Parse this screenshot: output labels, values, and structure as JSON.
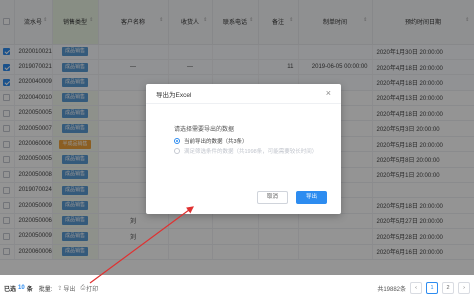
{
  "table": {
    "columns": [
      "流水号",
      "销售类型",
      "客户名称",
      "收货人",
      "联系电话",
      "备注",
      "制单时间",
      "预约时间日期"
    ],
    "rows": [
      {
        "checked": true,
        "id": "2020010021",
        "type": "成品销售",
        "type_color": "blue",
        "customer": "",
        "receiver": "",
        "phone": "",
        "note": "",
        "created": "",
        "appt": "2020年1月30日 20:00:00"
      },
      {
        "checked": true,
        "id": "2019070021",
        "type": "成品销售",
        "type_color": "blue",
        "customer": "—",
        "receiver": "—",
        "phone": "",
        "note": "11",
        "created": "2019-06-05 00:00:00",
        "appt": "2020年4月18日 20:00:00"
      },
      {
        "checked": true,
        "id": "2020040009",
        "type": "成品销售",
        "type_color": "blue",
        "customer": "",
        "receiver": "",
        "phone": "",
        "note": "",
        "created": "",
        "appt": "2020年4月18日 20:00:00"
      },
      {
        "checked": false,
        "id": "2020040010",
        "type": "成品销售",
        "type_color": "blue",
        "customer": "",
        "receiver": "",
        "phone": "",
        "note": "",
        "created": "",
        "appt": "2020年4月13日 20:00:00"
      },
      {
        "checked": false,
        "id": "2020050005",
        "type": "成品销售",
        "type_color": "blue",
        "customer": "",
        "receiver": "",
        "phone": "",
        "note": "",
        "created": "",
        "appt": "2020年4月18日 20:00:00"
      },
      {
        "checked": false,
        "id": "2020050007",
        "type": "成品销售",
        "type_color": "blue",
        "customer": "",
        "receiver": "",
        "phone": "",
        "note": "",
        "created": "",
        "appt": "2020年5月3日 20:00:00"
      },
      {
        "checked": false,
        "id": "2020060006",
        "type": "半成品销售",
        "type_color": "orange",
        "customer": "",
        "receiver": "",
        "phone": "",
        "note": "",
        "created": "",
        "appt": "2020年5月18日 20:00:00"
      },
      {
        "checked": false,
        "id": "2020050005",
        "type": "成品销售",
        "type_color": "blue",
        "customer": "",
        "receiver": "",
        "phone": "",
        "note": "",
        "created": "",
        "appt": "2020年5月8日 20:00:00"
      },
      {
        "checked": false,
        "id": "2020050008",
        "type": "成品销售",
        "type_color": "blue",
        "customer": "",
        "receiver": "",
        "phone": "",
        "note": "",
        "created": "",
        "appt": "2020年5月1日 20:00:00"
      },
      {
        "checked": false,
        "id": "2019070024",
        "type": "成品销售",
        "type_color": "blue",
        "customer": "",
        "receiver": "",
        "phone": "",
        "note": "10",
        "created": "",
        "appt": ""
      },
      {
        "checked": false,
        "id": "2020050009",
        "type": "成品销售",
        "type_color": "blue",
        "customer": "",
        "receiver": "",
        "phone": "",
        "note": "",
        "created": "",
        "appt": "2020年5月18日 20:00:00"
      },
      {
        "checked": false,
        "id": "2020050006",
        "type": "成品销售",
        "type_color": "blue",
        "customer": "刘",
        "receiver": "",
        "phone": "",
        "note": "",
        "created": "",
        "appt": "2020年5月27日 20:00:00"
      },
      {
        "checked": false,
        "id": "2020050009",
        "type": "成品销售",
        "type_color": "blue",
        "customer": "刘",
        "receiver": "",
        "phone": "",
        "note": "",
        "created": "",
        "appt": "2020年5月28日 20:00:00"
      },
      {
        "checked": false,
        "id": "2020060006",
        "type": "成品销售",
        "type_color": "blue",
        "customer": "",
        "receiver": "",
        "phone": "",
        "note": "",
        "created": "",
        "appt": "2020年6月16日 20:00:00"
      }
    ],
    "scroll_hint": "点击显示更多行"
  },
  "modal": {
    "title": "导出为Excel",
    "question": "请选择需要导出的数据",
    "option_selected": "当前导出的数据（共3条）",
    "option_disabled": "满足筛选条件的数据（共1998条，可能需要较长时间）",
    "cancel_label": "取消",
    "ok_label": "导出"
  },
  "footer": {
    "selected_prefix": "已选",
    "selected_count": "10",
    "selected_suffix": "条",
    "batch_label": "批量:",
    "export_label": "导出",
    "print_label": "打印",
    "total_label": "共19882条",
    "pages": [
      "1",
      "2"
    ],
    "prev": "‹",
    "next": "›"
  },
  "colors": {
    "accent": "#2d8cf0",
    "tag_blue": "#5b9bd5",
    "tag_orange": "#f0a33b",
    "arrow_red": "#e03030"
  }
}
